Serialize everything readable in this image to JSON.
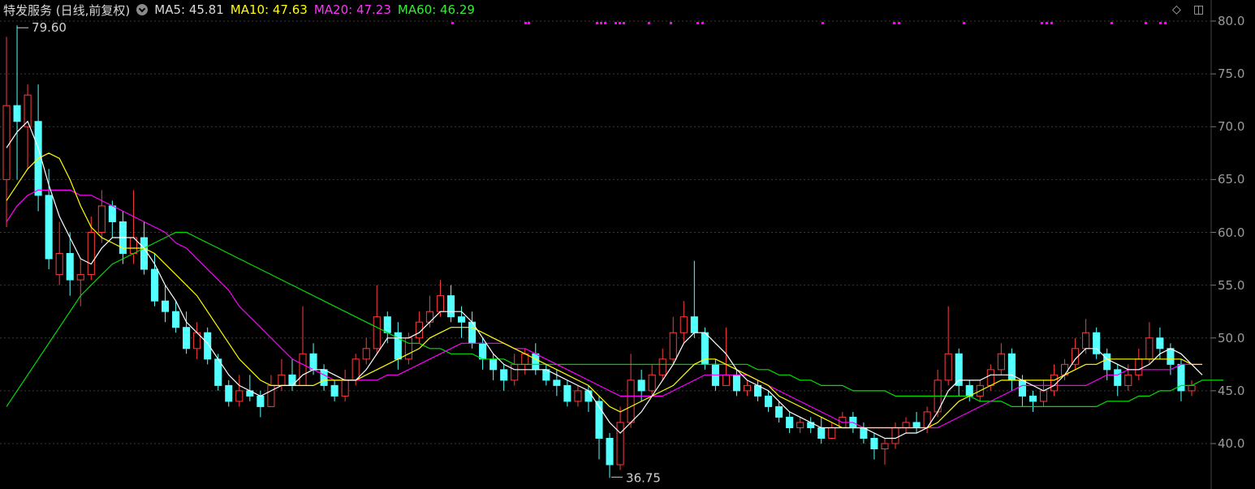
{
  "header": {
    "title": "特发服务 (日线,前复权)",
    "ma5": "MA5: 45.81",
    "ma10": "MA10: 47.63",
    "ma20": "MA20: 47.23",
    "ma60": "MA60: 46.29"
  },
  "colors": {
    "up": "#ff3b3b",
    "down": "#54ffff",
    "ma5": "#ffffff",
    "ma10": "#ffff00",
    "ma20": "#ff00ff",
    "ma60": "#00e000",
    "grid": "#3a3a3a"
  },
  "chart_data": {
    "type": "candlestick",
    "title": "特发服务 (日线,前复权)",
    "ylim": [
      37,
      81
    ],
    "yticks": [
      "80.0",
      "75.0",
      "70.0",
      "65.0",
      "60.0",
      "55.0",
      "50.0",
      "45.0",
      "40.0"
    ],
    "ytick_values": [
      80,
      75,
      70,
      65,
      60,
      55,
      50,
      45,
      40
    ],
    "annotations": {
      "high": "79.60",
      "low": "36.75"
    },
    "grid": true,
    "candles": [
      [
        65.0,
        72.0,
        78.5,
        60.5
      ],
      [
        72.0,
        70.5,
        79.6,
        65.0
      ],
      [
        70.0,
        73.0,
        74.0,
        66.0
      ],
      [
        70.5,
        63.5,
        74.0,
        62.0
      ],
      [
        63.5,
        57.5,
        66.0,
        56.5
      ],
      [
        56.0,
        58.0,
        61.0,
        55.0
      ],
      [
        58.0,
        55.5,
        60.0,
        54.0
      ],
      [
        55.5,
        56.0,
        57.5,
        53.0
      ],
      [
        56.0,
        60.0,
        61.5,
        55.5
      ],
      [
        60.0,
        62.5,
        64.0,
        59.0
      ],
      [
        62.5,
        61.0,
        63.0,
        59.5
      ],
      [
        61.0,
        58.0,
        62.0,
        57.0
      ],
      [
        58.0,
        59.5,
        64.0,
        57.0
      ],
      [
        59.5,
        56.5,
        61.0,
        56.0
      ],
      [
        56.5,
        53.5,
        58.0,
        53.0
      ],
      [
        53.5,
        52.5,
        55.0,
        51.5
      ],
      [
        52.5,
        51.0,
        53.5,
        50.5
      ],
      [
        51.0,
        49.0,
        52.5,
        48.5
      ],
      [
        49.0,
        50.5,
        51.5,
        48.0
      ],
      [
        50.5,
        48.0,
        51.0,
        47.5
      ],
      [
        48.0,
        45.5,
        48.5,
        45.0
      ],
      [
        45.5,
        44.0,
        46.0,
        43.5
      ],
      [
        44.0,
        45.0,
        46.5,
        43.5
      ],
      [
        45.0,
        44.5,
        46.5,
        44.0
      ],
      [
        44.5,
        43.5,
        45.0,
        42.5
      ],
      [
        43.5,
        45.5,
        46.5,
        43.5
      ],
      [
        45.5,
        46.5,
        48.0,
        45.0
      ],
      [
        46.5,
        45.5,
        48.0,
        45.0
      ],
      [
        45.5,
        48.5,
        53.0,
        45.5
      ],
      [
        48.5,
        47.0,
        49.5,
        46.5
      ],
      [
        47.0,
        45.5,
        47.5,
        45.0
      ],
      [
        45.5,
        44.5,
        46.0,
        44.0
      ],
      [
        44.5,
        46.0,
        47.0,
        44.0
      ],
      [
        46.0,
        48.0,
        48.5,
        45.5
      ],
      [
        48.0,
        49.0,
        50.0,
        47.5
      ],
      [
        49.0,
        52.0,
        55.0,
        48.5
      ],
      [
        52.0,
        50.5,
        52.5,
        49.5
      ],
      [
        50.5,
        48.0,
        51.5,
        47.0
      ],
      [
        48.0,
        50.0,
        50.5,
        47.5
      ],
      [
        50.0,
        51.5,
        52.5,
        49.5
      ],
      [
        51.5,
        52.5,
        54.0,
        51.0
      ],
      [
        52.5,
        54.0,
        55.5,
        52.0
      ],
      [
        54.0,
        52.0,
        55.0,
        51.5
      ],
      [
        52.0,
        51.5,
        53.0,
        50.0
      ],
      [
        51.5,
        49.5,
        52.5,
        49.0
      ],
      [
        49.5,
        48.0,
        50.0,
        47.0
      ],
      [
        48.0,
        47.0,
        48.5,
        46.0
      ],
      [
        47.0,
        46.0,
        47.5,
        45.0
      ],
      [
        46.0,
        47.5,
        48.5,
        45.5
      ],
      [
        47.5,
        48.5,
        49.0,
        46.5
      ],
      [
        48.5,
        47.0,
        49.5,
        46.5
      ],
      [
        47.0,
        46.0,
        47.5,
        45.5
      ],
      [
        46.0,
        45.5,
        47.0,
        44.5
      ],
      [
        45.5,
        44.0,
        46.0,
        43.5
      ],
      [
        44.0,
        45.0,
        45.5,
        43.5
      ],
      [
        45.0,
        44.0,
        45.5,
        43.0
      ],
      [
        44.0,
        40.5,
        44.5,
        38.5
      ],
      [
        40.5,
        38.0,
        41.0,
        36.75
      ],
      [
        38.0,
        42.0,
        43.5,
        37.5
      ],
      [
        42.0,
        46.0,
        48.5,
        41.5
      ],
      [
        46.0,
        45.0,
        47.0,
        44.0
      ],
      [
        45.0,
        46.5,
        47.5,
        44.5
      ],
      [
        46.5,
        48.0,
        49.0,
        46.0
      ],
      [
        48.0,
        50.5,
        52.0,
        47.5
      ],
      [
        50.5,
        52.0,
        53.5,
        49.5
      ],
      [
        52.0,
        50.5,
        57.3,
        50.0
      ],
      [
        50.5,
        47.5,
        51.0,
        47.0
      ],
      [
        47.5,
        45.5,
        48.0,
        45.0
      ],
      [
        45.5,
        46.5,
        51.0,
        45.5
      ],
      [
        46.5,
        45.0,
        47.0,
        44.5
      ],
      [
        45.0,
        45.5,
        46.0,
        44.5
      ],
      [
        45.5,
        44.5,
        46.0,
        44.0
      ],
      [
        44.5,
        43.5,
        45.0,
        43.0
      ],
      [
        43.5,
        42.5,
        44.0,
        42.0
      ],
      [
        42.5,
        41.5,
        43.0,
        41.0
      ],
      [
        41.5,
        42.0,
        42.5,
        41.0
      ],
      [
        42.0,
        41.5,
        42.5,
        41.0
      ],
      [
        41.5,
        40.5,
        42.5,
        40.0
      ],
      [
        40.5,
        41.5,
        42.0,
        40.5
      ],
      [
        41.5,
        42.5,
        43.0,
        41.5
      ],
      [
        42.5,
        41.5,
        43.0,
        41.0
      ],
      [
        41.5,
        40.5,
        42.0,
        40.0
      ],
      [
        40.5,
        39.5,
        41.0,
        38.5
      ],
      [
        39.5,
        40.0,
        40.5,
        38.0
      ],
      [
        40.0,
        41.5,
        42.0,
        39.5
      ],
      [
        41.5,
        42.0,
        42.5,
        41.0
      ],
      [
        42.0,
        41.5,
        43.0,
        41.0
      ],
      [
        41.5,
        43.0,
        43.5,
        41.0
      ],
      [
        43.0,
        46.0,
        47.0,
        42.5
      ],
      [
        46.0,
        48.5,
        53.0,
        45.5
      ],
      [
        48.5,
        45.5,
        49.0,
        44.5
      ],
      [
        45.5,
        44.5,
        46.0,
        44.0
      ],
      [
        44.5,
        45.5,
        46.0,
        44.0
      ],
      [
        45.5,
        47.0,
        47.5,
        45.0
      ],
      [
        47.0,
        48.5,
        49.5,
        46.5
      ],
      [
        48.5,
        46.0,
        49.0,
        45.0
      ],
      [
        46.0,
        44.5,
        46.5,
        43.5
      ],
      [
        44.5,
        44.0,
        45.0,
        43.0
      ],
      [
        44.0,
        45.0,
        46.0,
        43.5
      ],
      [
        45.0,
        46.5,
        47.5,
        44.5
      ],
      [
        46.5,
        47.5,
        48.0,
        46.0
      ],
      [
        47.5,
        49.0,
        50.0,
        47.0
      ],
      [
        49.0,
        50.5,
        51.8,
        48.5
      ],
      [
        50.5,
        48.5,
        51.0,
        48.0
      ],
      [
        48.5,
        47.0,
        49.0,
        46.0
      ],
      [
        47.0,
        45.5,
        47.5,
        44.5
      ],
      [
        45.5,
        46.5,
        47.5,
        45.0
      ],
      [
        46.5,
        48.0,
        49.0,
        46.0
      ],
      [
        48.0,
        50.0,
        51.5,
        47.5
      ],
      [
        50.0,
        49.0,
        51.0,
        48.0
      ],
      [
        49.0,
        47.5,
        49.5,
        46.5
      ],
      [
        47.5,
        45.0,
        48.0,
        44.0
      ],
      [
        45.0,
        45.5,
        46.0,
        44.5
      ]
    ],
    "ma5": [
      68.0,
      69.5,
      70.5,
      68.0,
      64.5,
      61.5,
      59.5,
      57.5,
      57.0,
      58.5,
      59.5,
      59.5,
      59.5,
      58.5,
      57.0,
      55.0,
      53.5,
      51.5,
      50.5,
      49.5,
      48.0,
      46.5,
      45.5,
      45.0,
      44.5,
      45.0,
      45.5,
      45.5,
      46.5,
      47.0,
      47.0,
      46.5,
      46.0,
      46.0,
      47.0,
      48.5,
      50.0,
      50.0,
      50.0,
      50.5,
      51.5,
      52.5,
      52.5,
      52.5,
      51.5,
      50.0,
      48.5,
      47.5,
      47.0,
      47.0,
      47.0,
      47.0,
      46.5,
      46.0,
      45.5,
      45.0,
      43.5,
      42.0,
      41.0,
      42.0,
      43.0,
      44.5,
      46.0,
      47.5,
      49.5,
      50.5,
      50.5,
      49.5,
      48.5,
      47.0,
      46.0,
      45.5,
      45.0,
      44.0,
      43.0,
      42.5,
      42.0,
      41.5,
      41.5,
      41.5,
      41.5,
      41.5,
      41.0,
      40.5,
      40.5,
      41.0,
      41.0,
      41.5,
      43.0,
      45.0,
      46.0,
      46.0,
      46.0,
      46.5,
      46.5,
      46.5,
      46.0,
      45.5,
      45.0,
      45.5,
      46.5,
      48.0,
      49.0,
      49.0,
      48.0,
      47.5,
      47.0,
      47.0,
      47.5,
      48.5,
      49.0,
      48.5,
      47.5,
      46.5
    ],
    "ma10": [
      63.0,
      64.5,
      66.0,
      67.0,
      67.5,
      67.0,
      65.0,
      62.5,
      60.5,
      59.5,
      59.0,
      58.5,
      58.5,
      58.5,
      58.0,
      57.0,
      56.0,
      55.0,
      54.0,
      52.5,
      51.0,
      49.5,
      48.0,
      47.0,
      46.0,
      45.5,
      45.5,
      45.5,
      45.5,
      45.5,
      46.0,
      46.0,
      46.0,
      46.0,
      46.5,
      47.0,
      47.5,
      48.0,
      48.5,
      49.0,
      50.0,
      50.5,
      51.0,
      51.0,
      51.0,
      50.5,
      50.0,
      49.5,
      49.0,
      48.5,
      48.0,
      47.5,
      47.0,
      46.5,
      46.0,
      45.5,
      44.5,
      43.5,
      43.0,
      43.5,
      44.0,
      44.5,
      45.0,
      45.5,
      46.5,
      47.5,
      48.0,
      48.0,
      47.5,
      47.0,
      46.5,
      46.0,
      45.5,
      44.5,
      44.0,
      43.5,
      43.0,
      42.5,
      42.0,
      41.5,
      41.5,
      41.5,
      41.5,
      41.5,
      41.5,
      41.5,
      41.5,
      41.5,
      42.0,
      43.0,
      44.0,
      44.5,
      45.0,
      45.5,
      46.0,
      46.0,
      46.0,
      46.0,
      46.0,
      46.0,
      46.5,
      47.0,
      47.5,
      47.5,
      48.0,
      48.0,
      48.0,
      48.0,
      48.0,
      48.0,
      48.0,
      48.0,
      47.5,
      47.5
    ],
    "ma20": [
      61.0,
      62.5,
      63.5,
      64.0,
      64.0,
      64.0,
      64.0,
      63.5,
      63.5,
      63.0,
      62.5,
      62.0,
      61.5,
      61.0,
      60.5,
      60.0,
      59.0,
      58.5,
      57.5,
      56.5,
      55.5,
      54.5,
      53.0,
      52.0,
      51.0,
      50.0,
      49.0,
      48.0,
      47.5,
      47.0,
      46.5,
      46.0,
      46.0,
      46.0,
      46.0,
      46.0,
      46.5,
      46.5,
      47.0,
      47.5,
      48.0,
      48.5,
      49.0,
      49.5,
      49.5,
      49.5,
      49.5,
      49.5,
      49.0,
      49.0,
      48.5,
      48.0,
      47.5,
      47.0,
      46.5,
      46.0,
      45.5,
      45.0,
      44.5,
      44.5,
      44.5,
      44.5,
      44.5,
      45.0,
      45.5,
      46.0,
      46.5,
      46.5,
      46.5,
      46.5,
      46.5,
      46.0,
      45.5,
      45.0,
      44.5,
      44.0,
      43.5,
      43.0,
      42.5,
      42.0,
      42.0,
      41.5,
      41.5,
      41.5,
      41.5,
      41.5,
      41.5,
      41.5,
      41.5,
      42.0,
      42.5,
      43.0,
      43.5,
      44.0,
      44.5,
      45.0,
      45.5,
      45.5,
      45.5,
      45.5,
      45.5,
      45.5,
      45.5,
      46.0,
      46.5,
      46.5,
      47.0,
      47.0,
      47.0,
      47.0,
      47.0,
      47.5,
      47.5,
      47.5
    ],
    "ma60": [
      43.5,
      45.0,
      46.5,
      48.0,
      49.5,
      51.0,
      52.5,
      54.0,
      55.0,
      56.0,
      57.0,
      57.5,
      58.0,
      58.5,
      59.0,
      59.5,
      60.0,
      60.0,
      59.5,
      59.0,
      58.5,
      58.0,
      57.5,
      57.0,
      56.5,
      56.0,
      55.5,
      55.0,
      54.5,
      54.0,
      53.5,
      53.0,
      52.5,
      52.0,
      51.5,
      51.0,
      50.5,
      50.0,
      49.5,
      49.5,
      49.0,
      49.0,
      48.5,
      48.5,
      48.5,
      48.0,
      48.0,
      48.0,
      47.5,
      47.5,
      47.5,
      47.5,
      47.5,
      47.5,
      47.5,
      47.5,
      47.5,
      47.5,
      47.5,
      47.5,
      47.5,
      47.5,
      47.5,
      47.5,
      47.5,
      47.5,
      47.5,
      47.5,
      47.5,
      47.5,
      47.5,
      47.0,
      47.0,
      46.5,
      46.5,
      46.0,
      46.0,
      45.5,
      45.5,
      45.5,
      45.0,
      45.0,
      45.0,
      45.0,
      44.5,
      44.5,
      44.5,
      44.5,
      44.5,
      44.5,
      44.5,
      44.5,
      44.0,
      44.0,
      44.0,
      43.5,
      43.5,
      43.5,
      43.5,
      43.5,
      43.5,
      43.5,
      43.5,
      43.5,
      44.0,
      44.0,
      44.0,
      44.5,
      44.5,
      45.0,
      45.0,
      45.5,
      45.5,
      46.0,
      46.0,
      46.0
    ]
  }
}
